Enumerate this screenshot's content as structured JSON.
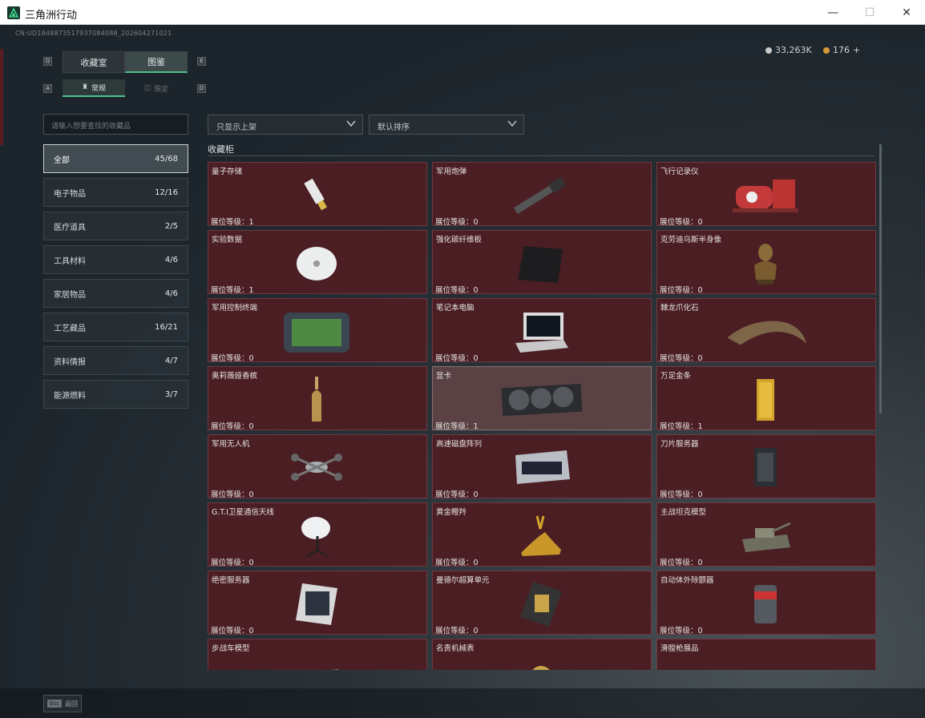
{
  "window": {
    "title": "三角洲行动",
    "minimize": "—",
    "maximize": "☐",
    "close": "✕"
  },
  "header": {
    "uid": "CN:UD1848873517937084088_202604271021",
    "silver": "33,263K",
    "gold": "176",
    "gold_add": "+"
  },
  "tabs": {
    "keys": {
      "left": "Q",
      "right": "E",
      "sub_left": "A",
      "sub_right": "D"
    },
    "main": [
      "收藏室",
      "图鉴"
    ],
    "sub": [
      "常规",
      "限定"
    ]
  },
  "search": {
    "placeholder": "请输入想要查找的收藏品"
  },
  "categories": [
    {
      "label": "全部",
      "count": "45/68"
    },
    {
      "label": "电子物品",
      "count": "12/16"
    },
    {
      "label": "医疗道具",
      "count": "2/5"
    },
    {
      "label": "工具材料",
      "count": "4/6"
    },
    {
      "label": "家居物品",
      "count": "4/6"
    },
    {
      "label": "工艺藏品",
      "count": "16/21"
    },
    {
      "label": "资料情报",
      "count": "4/7"
    },
    {
      "label": "能源燃料",
      "count": "3/7"
    }
  ],
  "filters": {
    "shelf": "只显示上架",
    "sort": "默认排序"
  },
  "section": {
    "title": "收藏柜"
  },
  "level_label": "展位等级：",
  "items": [
    {
      "name": "量子存储",
      "level": "1",
      "icon": "usb-drive-icon"
    },
    {
      "name": "军用炮弹",
      "level": "0",
      "icon": "artillery-shell-icon"
    },
    {
      "name": "飞行记录仪",
      "level": "0",
      "icon": "flight-recorder-icon"
    },
    {
      "name": "实验数据",
      "level": "1",
      "icon": "disc-icon"
    },
    {
      "name": "强化碳纤维板",
      "level": "0",
      "icon": "carbon-plate-icon"
    },
    {
      "name": "克劳迪乌斯半身像",
      "level": "0",
      "icon": "bust-icon"
    },
    {
      "name": "军用控制终端",
      "level": "0",
      "icon": "control-terminal-icon"
    },
    {
      "name": "笔记本电脑",
      "level": "0",
      "icon": "laptop-icon"
    },
    {
      "name": "棘龙爪化石",
      "level": "0",
      "icon": "claw-fossil-icon"
    },
    {
      "name": "奥莉薇娅香槟",
      "level": "0",
      "icon": "champagne-icon"
    },
    {
      "name": "显卡",
      "level": "1",
      "icon": "graphics-card-icon"
    },
    {
      "name": "万足金条",
      "level": "1",
      "icon": "gold-bar-icon"
    },
    {
      "name": "军用无人机",
      "level": "0",
      "icon": "drone-icon"
    },
    {
      "name": "高速磁盘阵列",
      "level": "0",
      "icon": "disk-array-icon"
    },
    {
      "name": "刀片服务器",
      "level": "0",
      "icon": "blade-server-icon"
    },
    {
      "name": "G.T.I卫星通信天线",
      "level": "0",
      "icon": "satellite-dish-icon"
    },
    {
      "name": "黄金瞪羚",
      "level": "0",
      "icon": "golden-gazelle-icon"
    },
    {
      "name": "主战坦克模型",
      "level": "0",
      "icon": "tank-model-icon"
    },
    {
      "name": "绝密服务器",
      "level": "0",
      "icon": "secret-server-icon"
    },
    {
      "name": "曼德尔超算单元",
      "level": "0",
      "icon": "supercomputer-unit-icon"
    },
    {
      "name": "自动体外除颤器",
      "level": "0",
      "icon": "defibrillator-icon"
    },
    {
      "name": "步战车模型",
      "level": "",
      "icon": "ifv-model-icon"
    },
    {
      "name": "名贵机械表",
      "level": "",
      "icon": "watch-icon"
    },
    {
      "name": "滑膛枪展品",
      "level": "",
      "icon": "musket-icon"
    }
  ],
  "footer": {
    "esc_key": "Esc",
    "esc_label": "返回"
  }
}
